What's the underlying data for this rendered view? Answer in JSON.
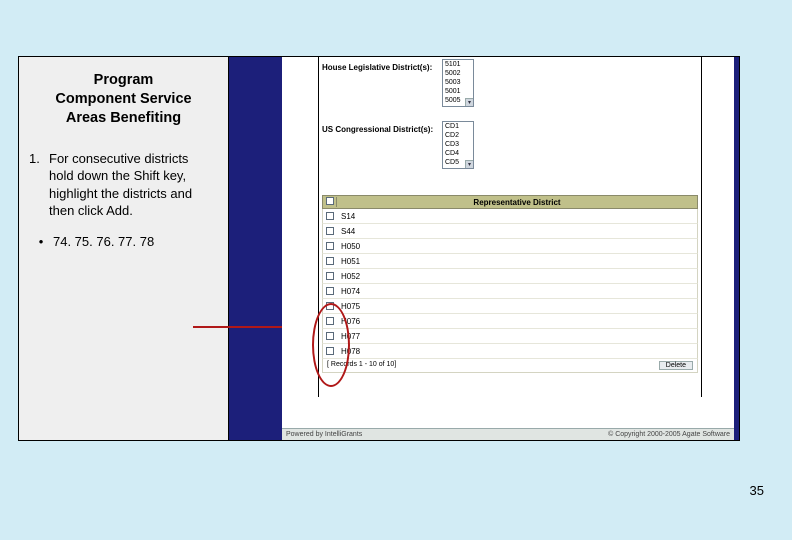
{
  "title_line1": "Program",
  "title_line2": "Component Service",
  "title_line3": "Areas Benefiting",
  "instruction": {
    "number": "1.",
    "text": "For consecutive districts hold down the Shift key, highlight the districts and then click Add."
  },
  "bullet": {
    "marker": "•",
    "text": "74. 75. 76. 77. 78"
  },
  "fields": {
    "house_label": "House Legislative District(s):",
    "house_opts": [
      "5101",
      "5002",
      "5003",
      "5001",
      "5005"
    ],
    "us_label": "US Congressional District(s):",
    "us_opts": [
      "CD1",
      "CD2",
      "CD3",
      "CD4",
      "CD5"
    ]
  },
  "table": {
    "header": "Representative District",
    "rows": [
      "S14",
      "S44",
      "H050",
      "H051",
      "H052",
      "H074",
      "H075",
      "H076",
      "H077",
      "H078"
    ],
    "footer_left": "[ Records 1 - 10 of  10]",
    "delete_label": "Delete"
  },
  "bottombar": {
    "left": "Powered by IntelliGrants",
    "right": "© Copyright 2000-2005 Agate Software"
  },
  "page_number": "35"
}
